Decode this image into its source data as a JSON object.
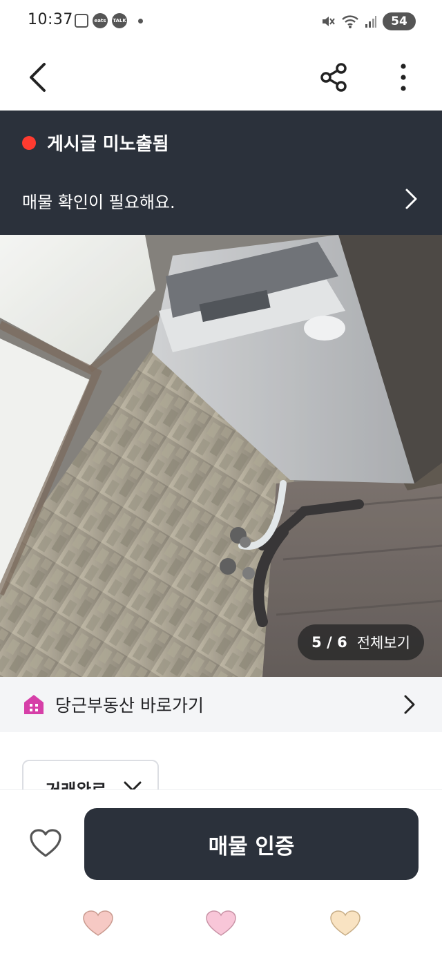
{
  "status_bar": {
    "time": "10:37",
    "app_icons": [
      "gallery-icon",
      "coupang-eats-icon",
      "kakaotalk-icon"
    ],
    "eats_label": "eats",
    "talk_label": "TALK",
    "battery": "54"
  },
  "app_bar": {
    "back_icon": "chevron-left-icon",
    "share_icon": "share-icon",
    "more_icon": "more-vertical-icon"
  },
  "banner": {
    "title": "게시글 미노출됨",
    "subtitle": "매물 확인이 필요해요.",
    "status_color": "#ff3b30",
    "background": "#2b313b"
  },
  "photo": {
    "counter_current": "5",
    "counter_total": "6",
    "counter_separator": "/",
    "view_all_label": "전체보기"
  },
  "realty_link": {
    "label": "당근부동산 바로가기",
    "icon": "house-icon",
    "icon_color": "#d63fa8"
  },
  "status_dropdown": {
    "label": "거래완료"
  },
  "action_bar": {
    "like_icon": "heart-outline-icon",
    "cta_label": "매물 인증"
  },
  "nav_bar": {
    "buttons": [
      "recent-apps-heart",
      "home-heart",
      "back-heart"
    ],
    "colors": [
      "#f6c9c4",
      "#f8c6d8",
      "#f9e3c2"
    ]
  }
}
